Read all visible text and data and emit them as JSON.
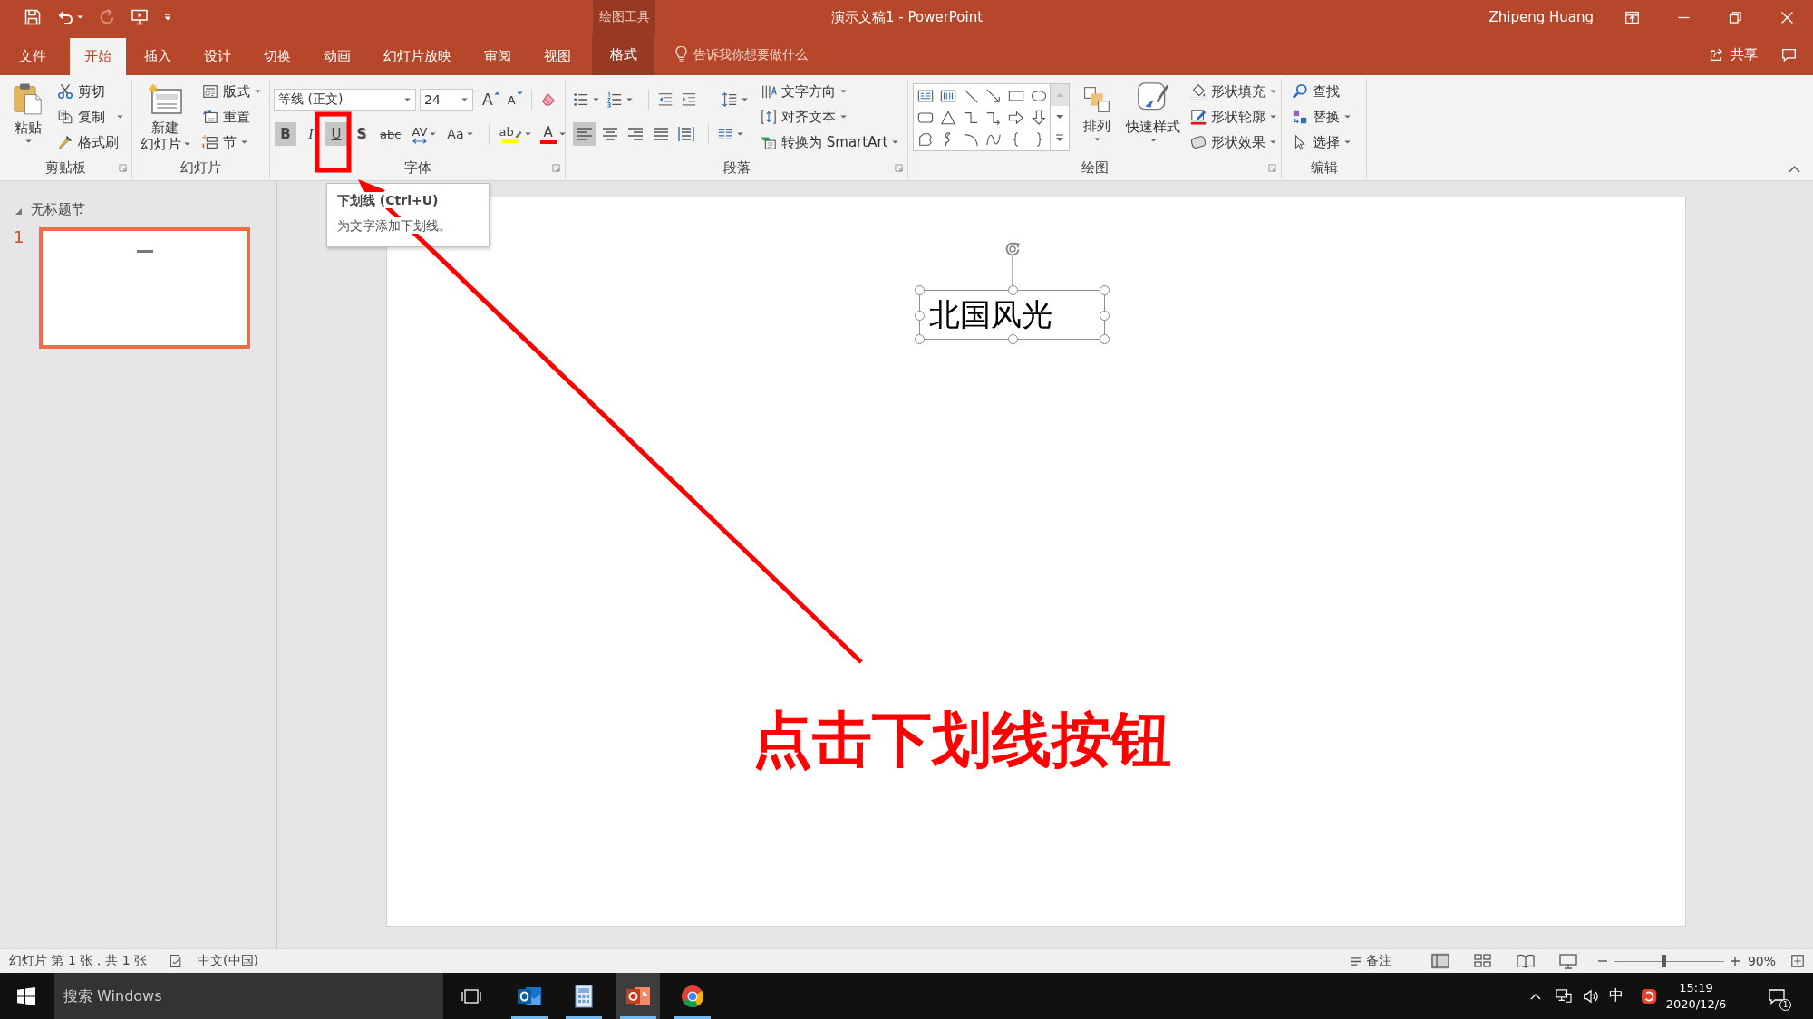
{
  "title_bar": {
    "quick_access": [
      {
        "kind": "save",
        "disabled": false,
        "dropdown": false
      },
      {
        "kind": "undo",
        "disabled": false,
        "dropdown": true
      },
      {
        "kind": "redo",
        "disabled": true,
        "dropdown": false
      },
      {
        "kind": "present",
        "disabled": false,
        "dropdown": false
      },
      {
        "kind": "customize",
        "disabled": false,
        "dropdown": false
      }
    ],
    "context_label": "绘图工具",
    "title": "演示文稿1 - PowerPoint",
    "user": "Zhipeng Huang"
  },
  "tabs": [
    {
      "label": "文件",
      "selected": false,
      "contextual": false
    },
    {
      "label": "开始",
      "selected": true,
      "contextual": false
    },
    {
      "label": "插入",
      "selected": false,
      "contextual": false
    },
    {
      "label": "设计",
      "selected": false,
      "contextual": false
    },
    {
      "label": "切换",
      "selected": false,
      "contextual": false
    },
    {
      "label": "动画",
      "selected": false,
      "contextual": false
    },
    {
      "label": "幻灯片放映",
      "selected": false,
      "contextual": false
    },
    {
      "label": "审阅",
      "selected": false,
      "contextual": false
    },
    {
      "label": "视图",
      "selected": false,
      "contextual": false
    },
    {
      "label": "格式",
      "selected": false,
      "contextual": true
    }
  ],
  "tell_me": {
    "label": "告诉我你想要做什么"
  },
  "share": {
    "label": "共享"
  },
  "ribbon": {
    "clipboard": {
      "label": "剪贴板",
      "paste": "粘贴",
      "items": [
        {
          "kind": "cut",
          "label": "剪切",
          "dropdown": false
        },
        {
          "kind": "copy",
          "label": "复制",
          "dropdown": true
        },
        {
          "kind": "format_painter",
          "label": "格式刷",
          "dropdown": false
        }
      ]
    },
    "slides": {
      "label": "幻灯片",
      "new_slide": [
        "新建",
        "幻灯片"
      ],
      "items": [
        {
          "kind": "layout",
          "label": "版式",
          "dropdown": true
        },
        {
          "kind": "reset",
          "label": "重置",
          "dropdown": false
        },
        {
          "kind": "section",
          "label": "节",
          "dropdown": true
        }
      ]
    },
    "font": {
      "label": "字体",
      "font_name": "等线 (正文)",
      "font_size": "24",
      "size_buttons": [
        {
          "kind": "grow",
          "glyph": "A"
        },
        {
          "kind": "shrink",
          "glyph": "A"
        }
      ],
      "format_buttons": [
        {
          "kind": "bold",
          "glyph": "B",
          "highlighted": true,
          "dropdown": false
        },
        {
          "kind": "italic",
          "glyph": "I",
          "highlighted": false,
          "dropdown": false
        },
        {
          "kind": "underline",
          "glyph": "U",
          "highlighted": true,
          "dropdown": false
        },
        {
          "kind": "shadow",
          "glyph": "S",
          "highlighted": false,
          "dropdown": false
        },
        {
          "kind": "strikethrough",
          "glyph": "abc",
          "highlighted": false,
          "dropdown": false
        },
        {
          "kind": "spacing",
          "glyph": "AV",
          "highlighted": false,
          "dropdown": true
        },
        {
          "kind": "case",
          "glyph": "Aa",
          "highlighted": false,
          "dropdown": true
        }
      ],
      "color_buttons": [
        {
          "kind": "highlight",
          "glyph": "ab",
          "color": "#ffff00"
        },
        {
          "kind": "font_color",
          "glyph": "A",
          "color": "#ff0000"
        }
      ]
    },
    "paragraph": {
      "label": "段落",
      "list_buttons": [
        {
          "kind": "bullets",
          "dropdown": true
        },
        {
          "kind": "numbering",
          "dropdown": true
        },
        {
          "kind": "decrease_indent",
          "dropdown": false
        },
        {
          "kind": "increase_indent",
          "dropdown": false
        },
        {
          "kind": "line_spacing",
          "dropdown": true
        }
      ],
      "align_buttons": [
        {
          "kind": "left",
          "selected": true
        },
        {
          "kind": "center",
          "selected": false
        },
        {
          "kind": "right",
          "selected": false
        },
        {
          "kind": "justify",
          "selected": false
        },
        {
          "kind": "distributed",
          "selected": false
        }
      ],
      "text_items": [
        {
          "kind": "text_direction",
          "label": "文字方向",
          "dropdown": true
        },
        {
          "kind": "align_text",
          "label": "对齐文本",
          "dropdown": true
        },
        {
          "kind": "smartart",
          "label": "转换为 SmartArt",
          "dropdown": true
        }
      ]
    },
    "drawing": {
      "label": "绘图",
      "arrange": "排列",
      "quick_styles": "快速样式",
      "format_items": [
        {
          "kind": "fill",
          "label": "形状填充"
        },
        {
          "kind": "outline",
          "label": "形状轮廓"
        },
        {
          "kind": "effects",
          "label": "形状效果"
        }
      ]
    },
    "editing": {
      "label": "编辑",
      "items": [
        {
          "kind": "find",
          "label": "查找",
          "dropdown": false
        },
        {
          "kind": "replace",
          "label": "替换",
          "dropdown": true
        },
        {
          "kind": "select",
          "label": "选择",
          "dropdown": true
        }
      ]
    }
  },
  "tooltip": {
    "title": "下划线 (Ctrl+U)",
    "description": "为文字添加下划线。"
  },
  "slide_panel": {
    "section": {
      "title": "无标题节",
      "expanded": true
    },
    "slides": [
      {
        "number": "1",
        "selected": true
      }
    ]
  },
  "slide": {
    "textbox": {
      "text": "北国风光",
      "selected": true
    }
  },
  "annotation": {
    "callout": "点击下划线按钮"
  },
  "status_bar": {
    "slide_info": "幻灯片 第 1 张，共 1 张",
    "language": "中文(中国)",
    "notes": "备注",
    "views": [
      {
        "kind": "normal",
        "selected": true
      },
      {
        "kind": "sorter",
        "selected": false
      },
      {
        "kind": "reading",
        "selected": false
      },
      {
        "kind": "slideshow",
        "selected": false
      }
    ],
    "zoom": {
      "level": 0.45,
      "reading": "90%"
    }
  },
  "taskbar": {
    "search": {
      "placeholder": "搜索 Windows"
    },
    "apps": [
      {
        "kind": "mail",
        "running": true,
        "selected": false
      },
      {
        "kind": "calculator",
        "running": true,
        "selected": false
      },
      {
        "kind": "presentation",
        "running": true,
        "selected": true
      },
      {
        "kind": "browser",
        "running": true,
        "selected": false
      }
    ],
    "tray": {
      "ime": "中",
      "time": "15:19",
      "date": "2020/12/6",
      "notifications": "1"
    }
  }
}
